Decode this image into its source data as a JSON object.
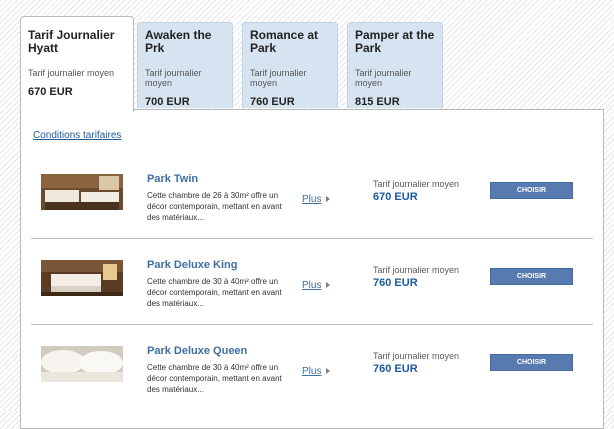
{
  "tabs": [
    {
      "name": "Tarif Journalier Hyatt",
      "sub": "Tarif journalier moyen",
      "price": "670 EUR"
    },
    {
      "name": "Awaken the Prk",
      "sub": "Tarif journalier moyen",
      "price": "700 EUR"
    },
    {
      "name": "Romance at Park",
      "sub": "Tarif journalier moyen",
      "price": "760 EUR"
    },
    {
      "name": "Pamper at the Park",
      "sub": "Tarif journalier moyen",
      "price": "815 EUR"
    }
  ],
  "conditions_link": "Conditions tarifaires",
  "rooms": [
    {
      "name": "Park Twin",
      "desc": "Cette chambre de 26 à 30m² offre un décor contemporain, mettant en avant des matériaux...",
      "more": "Plus",
      "rate_label": "Tarif journalier moyen",
      "rate": "670 EUR",
      "button": "CHOISIR"
    },
    {
      "name": "Park Deluxe King",
      "desc": "Cette chambre de 30 à 40m² offre un décor contemporain, mettant en avant des matériaux...",
      "more": "Plus",
      "rate_label": "Tarif journalier moyen",
      "rate": "760 EUR",
      "button": "CHOISIR"
    },
    {
      "name": "Park Deluxe Queen",
      "desc": "Cette chambre de 30 à 40m² offre un décor contemporain, mettant en avant des matériaux...",
      "more": "Plus",
      "rate_label": "Tarif journalier moyen",
      "rate": "760 EUR",
      "button": "CHOISIR"
    }
  ],
  "colors": {
    "accent": "#1c5aa0",
    "tab_bg": "#d6e4f1",
    "button": "#577bb0"
  }
}
